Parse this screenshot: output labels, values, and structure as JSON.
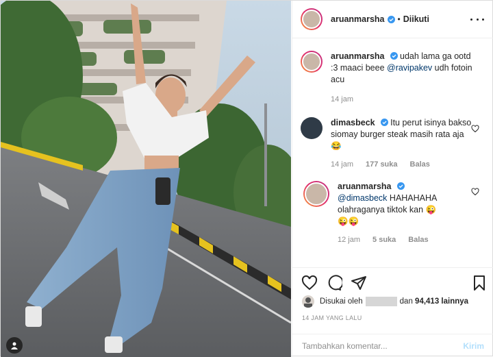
{
  "post": {
    "author": "aruanmarsha",
    "follow_sep": "•",
    "follow_status": "Diikuti"
  },
  "caption": {
    "username": "aruanmarsha",
    "text_before": "udah lama ga ootd :3 maaci beee ",
    "mention": "@ravipakev",
    "text_after": " udh fotoin acu",
    "time": "14 jam"
  },
  "comments": [
    {
      "username": "dimasbeck",
      "text": "Itu perut isinya bakso siomay burger steak masih rata aja 😂",
      "time": "14 jam",
      "likes": "177 suka",
      "reply": "Balas"
    },
    {
      "username": "aruanmarsha",
      "mention": "@dimasbeck",
      "text": " HAHAHAHA olahraganya tiktok kan 😜",
      "text2": "😜😜",
      "time": "12 jam",
      "likes": "5 suka",
      "reply": "Balas"
    }
  ],
  "likes": {
    "prefix": "Disukai oleh",
    "middle": "dan",
    "count": "94,413 lainnya"
  },
  "timestamp": "14 JAM YANG LALU",
  "add_comment": {
    "placeholder": "Tambahkan komentar...",
    "send_label": "Kirim"
  },
  "colors": {
    "verified": "#3897f0",
    "mention": "#00376b",
    "send_disabled": "#b2dffc"
  },
  "icons": [
    "heart-icon",
    "comment-icon",
    "share-icon",
    "bookmark-icon",
    "verified-icon",
    "user-icon",
    "more-icon"
  ]
}
